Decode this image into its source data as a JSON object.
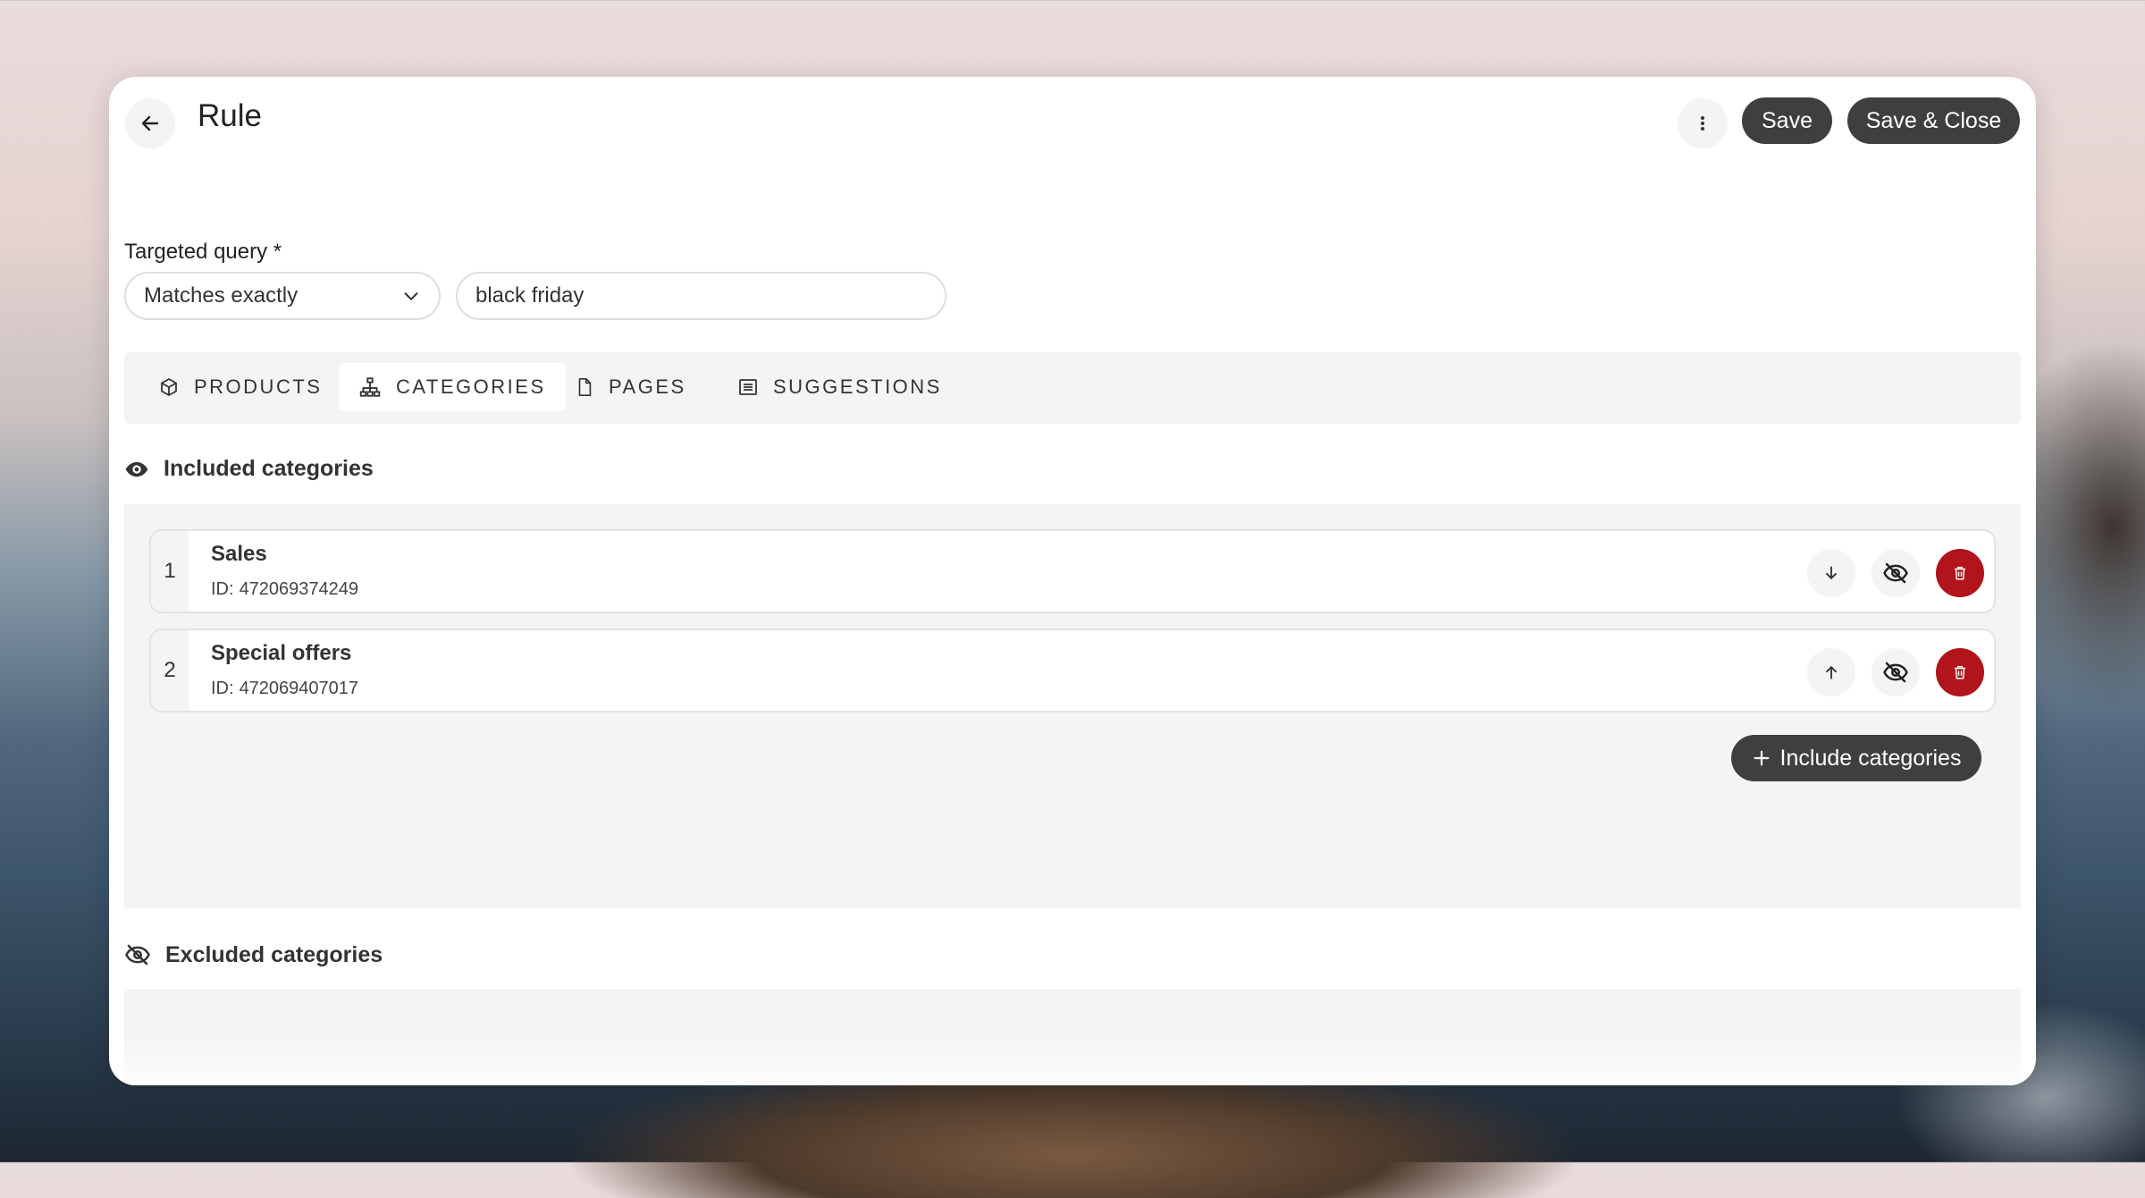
{
  "header": {
    "title": "Rule",
    "save_label": "Save",
    "save_close_label": "Save & Close"
  },
  "query": {
    "label": "Targeted query *",
    "match_type": "Matches exactly",
    "value": "black friday"
  },
  "tabs": [
    {
      "label": "PRODUCTS",
      "icon": "box-icon",
      "active": false
    },
    {
      "label": "CATEGORIES",
      "icon": "hierarchy-icon",
      "active": true
    },
    {
      "label": "PAGES",
      "icon": "document-icon",
      "active": false
    },
    {
      "label": "SUGGESTIONS",
      "icon": "list-icon",
      "active": false
    }
  ],
  "included": {
    "heading": "Included categories",
    "id_prefix": "ID:",
    "items": [
      {
        "index": "1",
        "name": "Sales",
        "id": "472069374249",
        "move": "down"
      },
      {
        "index": "2",
        "name": "Special offers",
        "id": "472069407017",
        "move": "up"
      }
    ],
    "add_label": "Include categories"
  },
  "excluded": {
    "heading": "Excluded categories"
  },
  "colors": {
    "dark_button": "#3f3f3f",
    "danger": "#b1141a",
    "surface": "#f4f4f4"
  }
}
